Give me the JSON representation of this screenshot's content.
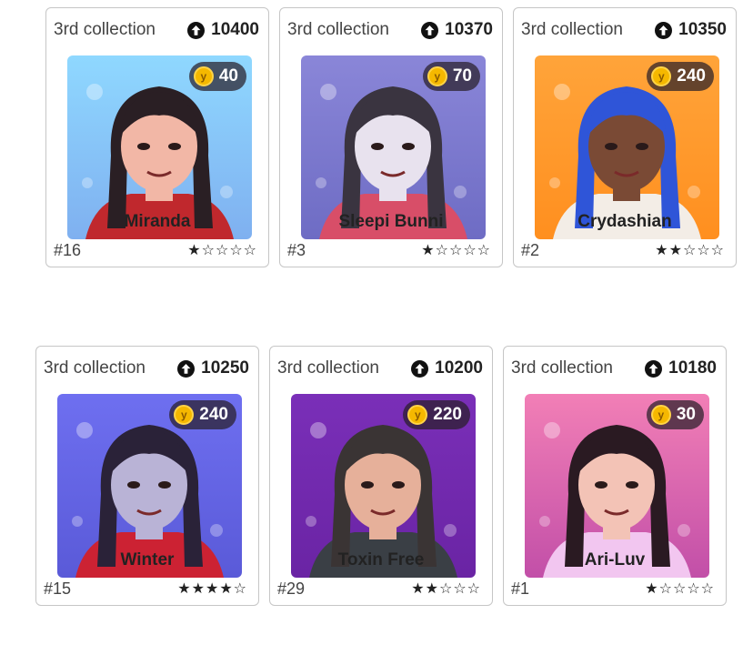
{
  "cards": [
    {
      "collection": "3rd collection",
      "score": "10400",
      "price": "40",
      "name": "Miranda",
      "rank": "#16",
      "stars": "★☆☆☆☆",
      "art": {
        "bg1": "#8fd8ff",
        "bg2": "#7fb0f0",
        "skin": "#f2b7a6",
        "hair": "#2a1f24",
        "cloth": "#c0282d"
      }
    },
    {
      "collection": "3rd collection",
      "score": "10370",
      "price": "70",
      "name": "Sleepi Bunni",
      "rank": "#3",
      "stars": "★☆☆☆☆",
      "art": {
        "bg1": "#8a86d8",
        "bg2": "#6e6cc4",
        "skin": "#e8e2ee",
        "hair": "#3a3440",
        "cloth": "#d84e68"
      }
    },
    {
      "collection": "3rd collection",
      "score": "10350",
      "price": "240",
      "name": "Crydashian",
      "rank": "#2",
      "stars": "★★☆☆☆",
      "art": {
        "bg1": "#ffa43a",
        "bg2": "#ff8f1f",
        "skin": "#7a4a35",
        "hair": "#2f55d8",
        "cloth": "#f3ede6"
      }
    },
    {
      "collection": "3rd collection",
      "score": "10250",
      "price": "240",
      "name": "Winter",
      "rank": "#15",
      "stars": "★★★★☆",
      "art": {
        "bg1": "#6e6ff0",
        "bg2": "#5a5ad8",
        "skin": "#b9b3d6",
        "hair": "#2a2238",
        "cloth": "#cc2233"
      }
    },
    {
      "collection": "3rd collection",
      "score": "10200",
      "price": "220",
      "name": "Toxin Free",
      "rank": "#29",
      "stars": "★★☆☆☆",
      "art": {
        "bg1": "#7a2fb8",
        "bg2": "#6a24a4",
        "skin": "#e6b09a",
        "hair": "#3a3434",
        "cloth": "#3a3f45"
      }
    },
    {
      "collection": "3rd collection",
      "score": "10180",
      "price": "30",
      "name": "Ari-Luv",
      "rank": "#1",
      "stars": "★☆☆☆☆",
      "art": {
        "bg1": "#f27fb6",
        "bg2": "#c24fa8",
        "skin": "#f3c3b6",
        "hair": "#2a1a22",
        "cloth": "#f2c6f0"
      }
    }
  ]
}
